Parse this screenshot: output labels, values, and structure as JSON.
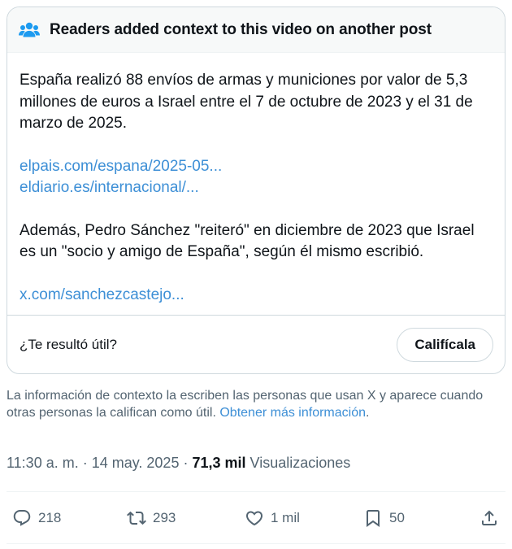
{
  "note": {
    "header_title": "Readers added context to this video on another post",
    "header_icon": "people-icon",
    "paragraph1": "España realizó 88 envíos de armas y municiones por valor de 5,3 millones de euros a Israel entre el 7 de octubre de 2023 y el 31 de marzo de 2025.",
    "link1": "elpais.com/espana/2025-05...",
    "link2": "eldiario.es/internacional/...",
    "paragraph2": "Además, Pedro Sánchez \"reiteró\" en diciembre de 2023 que Israel es un \"socio y amigo de España\", según él mismo escribió.",
    "link3": "x.com/sanchezcastejo...",
    "helpful_question": "¿Te resultó útil?",
    "rate_label": "Califícala"
  },
  "disclaimer": {
    "text": "La información de contexto la escriben las personas que usan X y aparece cuando otras personas la califican como útil.",
    "learn_more": "Obtener más información",
    "period": "."
  },
  "meta": {
    "time": "11:30 a. m.",
    "separator": " · ",
    "date": "14 may. 2025",
    "views_count": "71,3 mil",
    "views_label": "Visualizaciones"
  },
  "actions": {
    "replies": "218",
    "reposts": "293",
    "likes": "1 mil",
    "bookmarks": "50"
  },
  "colors": {
    "link": "#3d8fd6",
    "secondary_text": "#536471",
    "border": "#cfd9de"
  }
}
